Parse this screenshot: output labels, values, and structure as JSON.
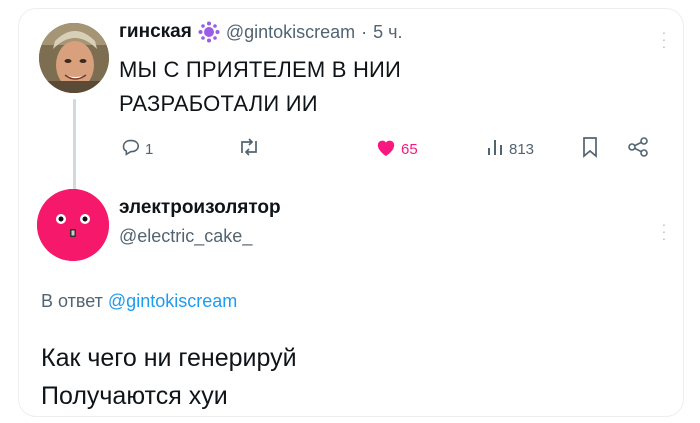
{
  "original_tweet": {
    "author_name": "гинская",
    "author_handle": "@gintokiscream",
    "separator": "·",
    "timestamp": "5 ч.",
    "text_line1": "МЫ С ПРИЯТЕЛЕМ В НИИ",
    "text_line2": "РАЗРАБОТАЛИ ИИ",
    "actions": {
      "reply_count": "1",
      "retweet_count": "",
      "like_count": "65",
      "views_count": "813"
    },
    "colors": {
      "like": "#f91880",
      "muted": "#536471"
    }
  },
  "reply_tweet": {
    "author_name": "электроизолятор",
    "author_handle": "@electric_cake_",
    "reply_prefix": "В ответ",
    "reply_mention": "@gintokiscream",
    "text_line1": "Как чего ни генерируй",
    "text_line2": "Получаются хуи",
    "colors": {
      "avatar": "#f6186b",
      "mention": "#1d9bf0"
    }
  },
  "icons": [
    "purple-splat-icon",
    "reply-icon",
    "retweet-icon",
    "heart-icon",
    "views-icon",
    "bookmark-icon",
    "share-icon",
    "more-icon"
  ]
}
